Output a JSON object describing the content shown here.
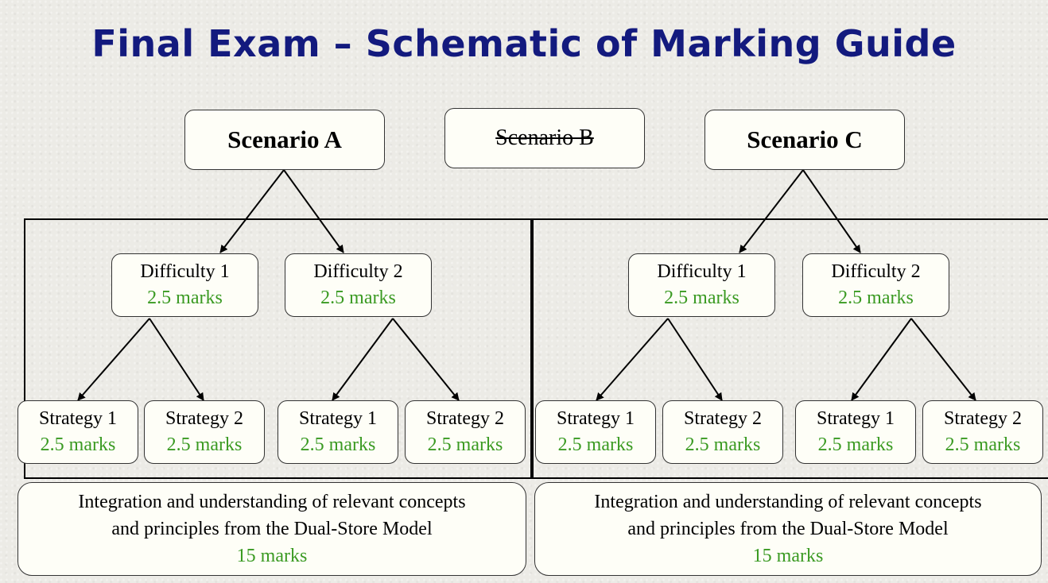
{
  "title": "Final Exam – Schematic of Marking Guide",
  "scenarios": {
    "a": "Scenario A",
    "b": "Scenario B",
    "c": "Scenario C"
  },
  "left": {
    "difficulties": [
      {
        "label": "Difficulty 1",
        "marks": "2.5 marks"
      },
      {
        "label": "Difficulty 2",
        "marks": "2.5 marks"
      }
    ],
    "strategies": [
      {
        "label": "Strategy 1",
        "marks": "2.5 marks"
      },
      {
        "label": "Strategy 2",
        "marks": "2.5 marks"
      },
      {
        "label": "Strategy 1",
        "marks": "2.5 marks"
      },
      {
        "label": "Strategy 2",
        "marks": "2.5 marks"
      }
    ],
    "summary": {
      "line1": "Integration and understanding of relevant concepts",
      "line2": "and principles from the Dual-Store Model",
      "marks": "15 marks"
    }
  },
  "right": {
    "difficulties": [
      {
        "label": "Difficulty 1",
        "marks": "2.5 marks"
      },
      {
        "label": "Difficulty 2",
        "marks": "2.5 marks"
      }
    ],
    "strategies": [
      {
        "label": "Strategy 1",
        "marks": "2.5 marks"
      },
      {
        "label": "Strategy 2",
        "marks": "2.5 marks"
      },
      {
        "label": "Strategy 1",
        "marks": "2.5 marks"
      },
      {
        "label": "Strategy 2",
        "marks": "2.5 marks"
      }
    ],
    "summary": {
      "line1": "Integration and understanding of relevant concepts",
      "line2": "and principles from the Dual-Store Model",
      "marks": "15 marks"
    }
  },
  "colors": {
    "title": "#131a7e",
    "marks": "#3a9a22"
  }
}
